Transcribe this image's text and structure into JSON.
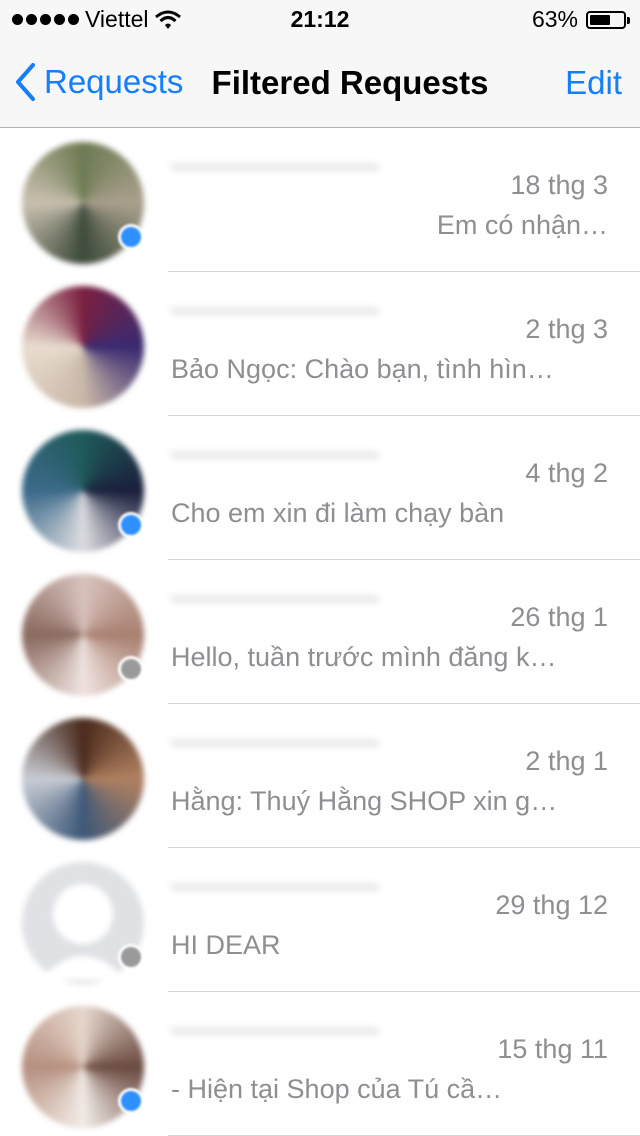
{
  "status": {
    "carrier": "Viettel",
    "time": "21:12",
    "battery_text": "63%",
    "battery_level": 0.63
  },
  "nav": {
    "back_label": "Requests",
    "title": "Filtered Requests",
    "edit_label": "Edit"
  },
  "messages": [
    {
      "date": "18 thg 3",
      "preview": "Em có nhận…",
      "badge": "messenger",
      "avatar_colors": [
        "#6d7a52",
        "#a9a08d",
        "#3d4a3a",
        "#c9c0b0"
      ],
      "align": "right"
    },
    {
      "date": "2 thg 3",
      "preview": "Bảo Ngọc: Chào bạn, tình hìn…",
      "badge": "none",
      "avatar_colors": [
        "#7a2040",
        "#3a2a70",
        "#c9b8a8",
        "#e8dccf"
      ],
      "align": "left"
    },
    {
      "date": "4 thg 2",
      "preview": "Cho em xin đi làm chạy bàn",
      "badge": "messenger",
      "avatar_colors": [
        "#1f5a5a",
        "#1a1f3c",
        "#dcdce0",
        "#3c6a8a"
      ],
      "align": "left"
    },
    {
      "date": "26 thg 1",
      "preview": "Hello, tuần trước mình đăng k…",
      "badge": "gray",
      "avatar_colors": [
        "#d9c2bd",
        "#a88070",
        "#efe2df",
        "#8a6a60"
      ],
      "align": "left"
    },
    {
      "date": "2 thg 1",
      "preview": "Hằng: Thuý Hằng SHOP xin g…",
      "badge": "none",
      "avatar_colors": [
        "#4a2a1c",
        "#b08060",
        "#3e5878",
        "#c8ccd4"
      ],
      "align": "left"
    },
    {
      "date": "29 thg 12",
      "preview": "HI DEAR",
      "badge": "gray",
      "avatar_colors": [
        "#dfe1e5",
        "#dfe1e5",
        "#c9ccd1",
        "#dfe1e5"
      ],
      "align": "left"
    },
    {
      "date": "15 thg 11",
      "preview": "- Hiện tại Shop của Tú cầ…",
      "badge": "messenger",
      "avatar_colors": [
        "#e6d6cc",
        "#6a4a40",
        "#f2ebe6",
        "#b69080"
      ],
      "align": "left"
    }
  ]
}
